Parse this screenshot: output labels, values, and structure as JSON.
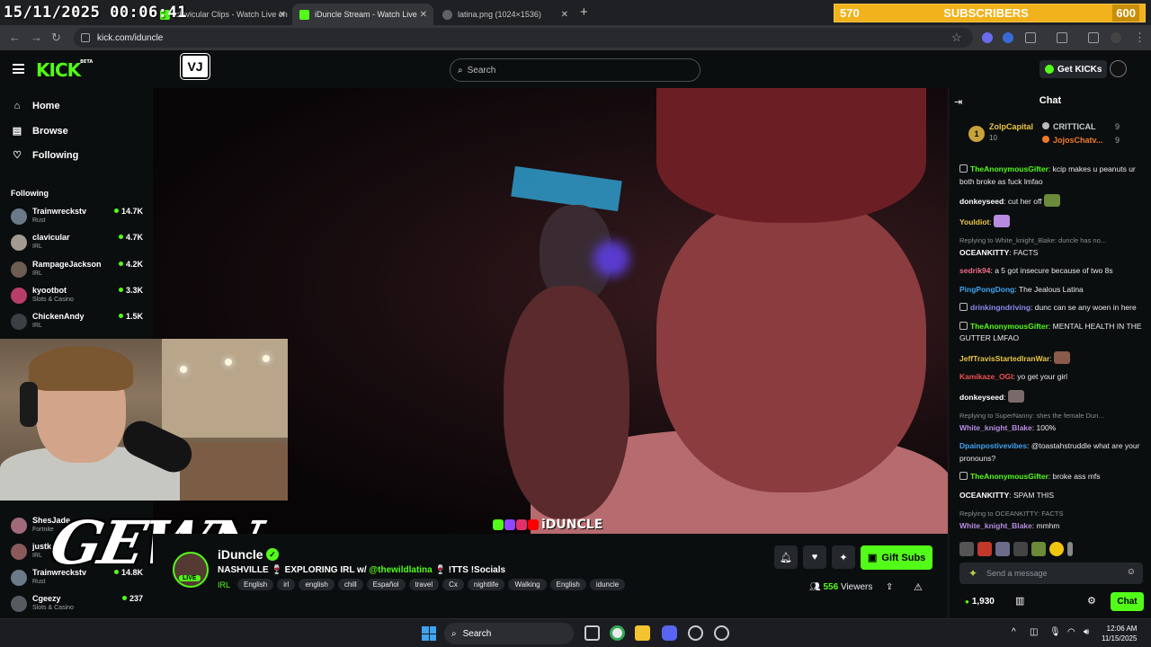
{
  "overlay": {
    "clock": "15/11/2025 00:06:41",
    "subs_left": "570",
    "subs_label": "SUBSCRIBERS",
    "subs_right": "600",
    "gewn": "GEWN"
  },
  "browser": {
    "tabs": [
      {
        "title": "clavicular Clips - Watch Live on"
      },
      {
        "title": "iDuncle Stream - Watch Live"
      },
      {
        "title": "latina.png (1024×1536)"
      }
    ],
    "url": "kick.com/iduncle"
  },
  "header": {
    "logo": "KICK",
    "logo_beta": "BETA",
    "search_placeholder": "Search",
    "get_kicks": "Get KICKs"
  },
  "sidebar": {
    "nav": [
      {
        "label": "Home",
        "icon": "home-icon"
      },
      {
        "label": "Browse",
        "icon": "browse-icon"
      },
      {
        "label": "Following",
        "icon": "heart-icon"
      }
    ],
    "following_title": "Following",
    "channels": [
      {
        "name": "Trainwreckstv",
        "category": "Rust",
        "viewers": "14.7K",
        "color": "#6b7a88"
      },
      {
        "name": "clavicular",
        "category": "IRL",
        "viewers": "4.7K",
        "color": "#a29b92"
      },
      {
        "name": "RampageJackson",
        "category": "IRL",
        "viewers": "4.2K",
        "color": "#6d5c52"
      },
      {
        "name": "kyootbot",
        "category": "Slots & Casino",
        "viewers": "3.3K",
        "color": "#b83e6a"
      },
      {
        "name": "ChickenAndy",
        "category": "IRL",
        "viewers": "1.5K",
        "color": "#3c3f44"
      }
    ],
    "channels_lower": [
      {
        "name": "ShesJade",
        "category": "Fortnite",
        "viewers": "",
        "color": "#a06a7a"
      },
      {
        "name": "justke",
        "category": "IRL",
        "viewers": "",
        "color": "#8a5a5a"
      },
      {
        "name": "Trainwreckstv",
        "category": "Rust",
        "viewers": "14.8K",
        "color": "#6b7a88"
      },
      {
        "name": "Cgeezy",
        "category": "Slots & Casino",
        "viewers": "237",
        "color": "#555b61"
      }
    ]
  },
  "video": {
    "watermark": "iDUNCLE"
  },
  "stream": {
    "name": "iDuncle",
    "live": "LIVE",
    "title_before": "NASHVILLE 🍷 EXPLORING IRL w/ ",
    "title_mention": "@thewildlatina",
    "title_after": " 🍷 !TTS !Socials",
    "category": "IRL",
    "tags": [
      "English",
      "irl",
      "english",
      "chill",
      "Español",
      "travel",
      "Cx",
      "nightlife",
      "Walking",
      "English",
      "iduncle"
    ],
    "gift_subs": "Gift Subs",
    "viewers_count": "556",
    "viewers_label": "Viewers"
  },
  "chat": {
    "title": "Chat",
    "leaderboard": {
      "rank": "1",
      "top_name": "ZolpCapital",
      "top_sub": "10",
      "row1_name": "CRITTICAL",
      "row1_count": "9",
      "row2_name": "JojosChatv...",
      "row2_count": "9"
    },
    "messages": [
      {
        "user": "TheAnonymousGifter",
        "color": "#53fc18",
        "text": ": kcip makes u peanuts ur both broke as fuck lmfao",
        "reply": "",
        "badge": true
      },
      {
        "user": "donkeyseed",
        "color": "#ffffff",
        "text": ": cut her off ",
        "reply": "",
        "emote": "#6b8a3a"
      },
      {
        "user": "Youldiot",
        "color": "#e8c547",
        "text": ": ",
        "reply": "",
        "emote": "#b78ce0"
      },
      {
        "user": "OCEANKITTY",
        "color": "#ffffff",
        "text": ": FACTS",
        "reply": "Replying to White_knight_Blake: duncle has no...",
        "badge": false
      },
      {
        "user": "sedrik94",
        "color": "#f06a8a",
        "text": ": a 5 got insecure because of two 8s",
        "reply": ""
      },
      {
        "user": "PingPongDong",
        "color": "#3fa4f0",
        "text": ": The Jealous Latina",
        "reply": ""
      },
      {
        "user": "drinkingndriving",
        "color": "#8b8cf0",
        "text": ": dunc can se any woen in here",
        "reply": "",
        "badge": true
      },
      {
        "user": "TheAnonymousGifter",
        "color": "#53fc18",
        "text": ": MENTAL HEALTH IN THE GUTTER LMFAO",
        "reply": "",
        "badge": true
      },
      {
        "user": "JeffTravisStartedIranWar",
        "color": "#e8c547",
        "text": ": ",
        "reply": "",
        "emote": "#8a5a4a"
      },
      {
        "user": "Kamikaze_OGI",
        "color": "#f04f4f",
        "text": ": yo get your girl",
        "reply": ""
      },
      {
        "user": "donkeyseed",
        "color": "#ffffff",
        "text": ": ",
        "reply": "",
        "emote": "#7a6a6a"
      },
      {
        "user": "White_knight_Blake",
        "color": "#b78ce0",
        "text": ": 100%",
        "reply": "Replying to SuperNanny: shes the female Dun..."
      },
      {
        "user": "Dpainpostivevibes",
        "color": "#3fa4f0",
        "text": ": @toastahstruddle what are your pronouns?",
        "reply": ""
      },
      {
        "user": "TheAnonymousGifter",
        "color": "#53fc18",
        "text": ": broke ass mfs",
        "reply": "",
        "badge": true
      },
      {
        "user": "OCEANKITTY",
        "color": "#ffffff",
        "text": ": SPAM THIS",
        "reply": ""
      },
      {
        "user": "White_knight_Blake",
        "color": "#b78ce0",
        "text": ": mmhm",
        "reply": "Replying to OCEANKITTY: FACTS"
      }
    ],
    "input_placeholder": "Send a message",
    "points": "1,930",
    "chat_button": "Chat"
  },
  "taskbar": {
    "search": "Search",
    "time": "12:06 AM",
    "date": "11/15/2025"
  }
}
